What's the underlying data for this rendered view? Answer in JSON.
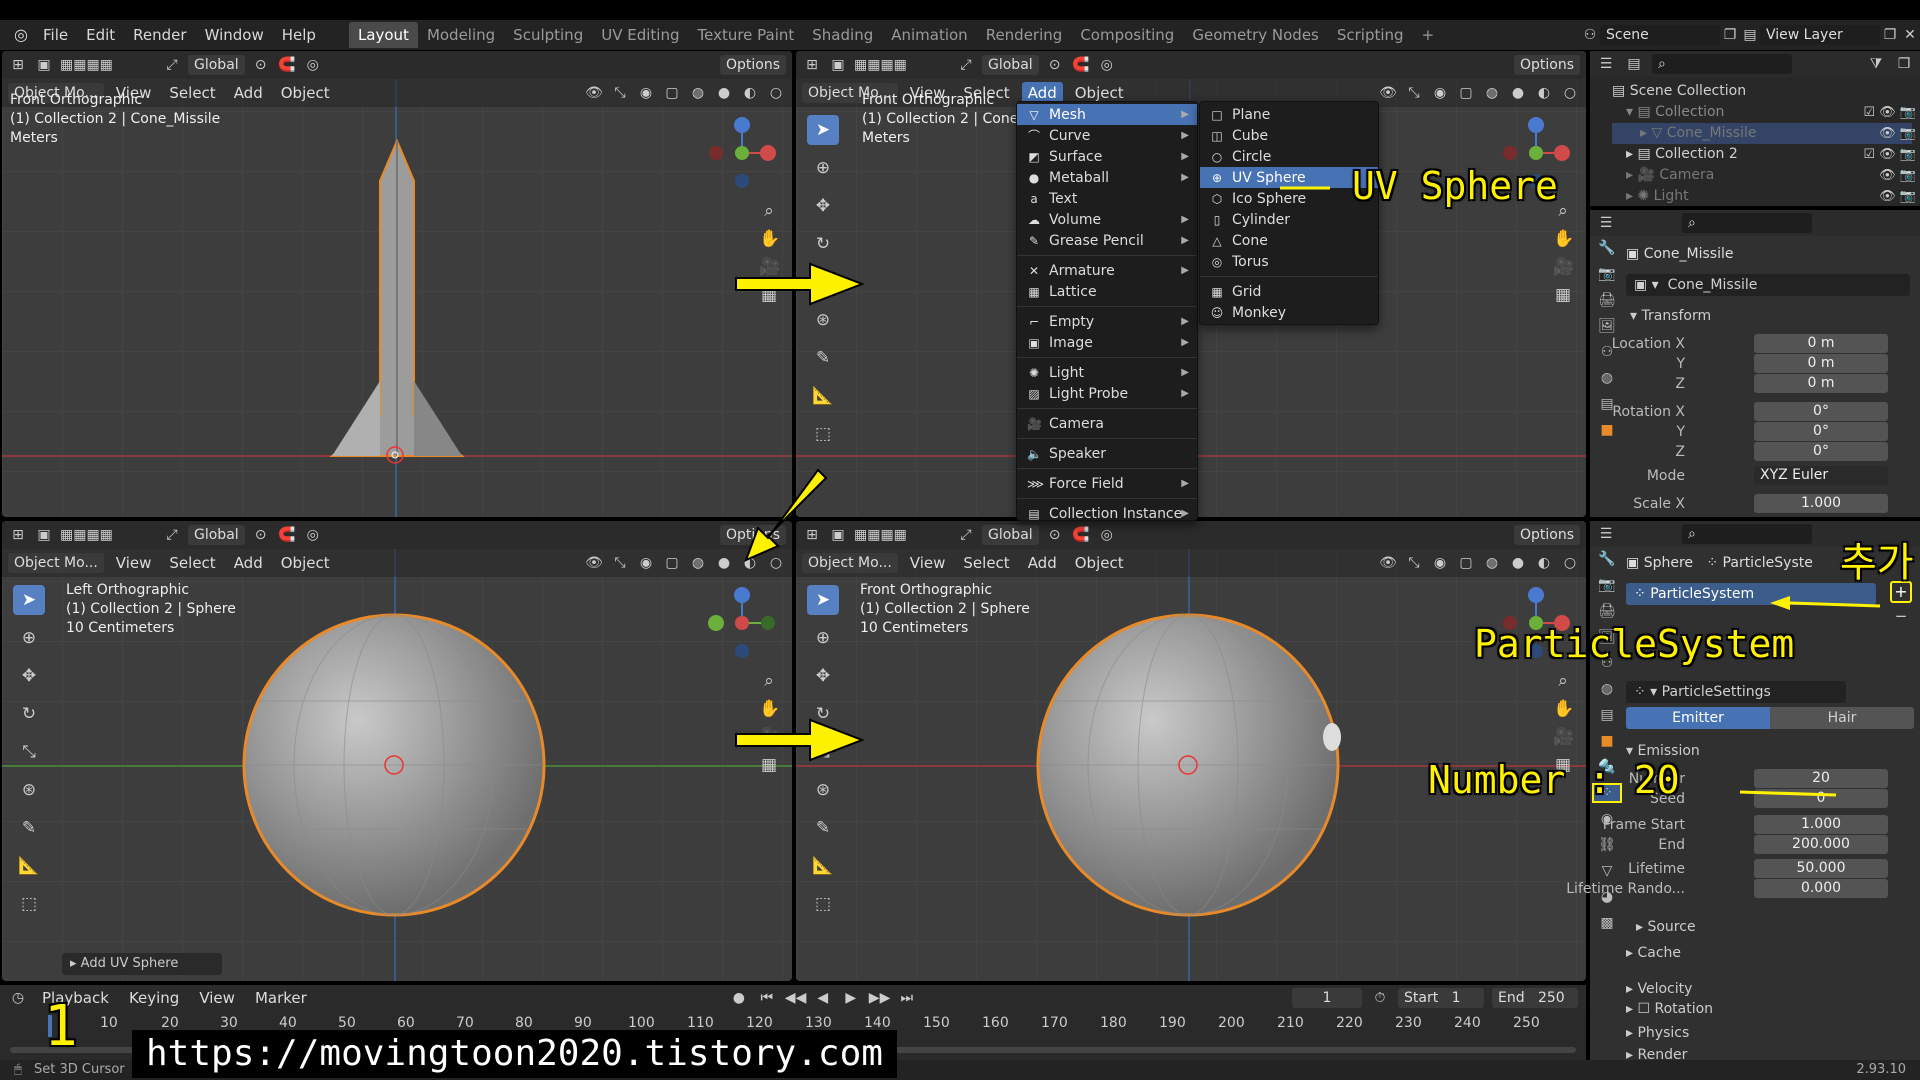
{
  "menubar": {
    "file": "File",
    "edit": "Edit",
    "render": "Render",
    "window": "Window",
    "help": "Help"
  },
  "workspaces": [
    "Layout",
    "Modeling",
    "Sculpting",
    "UV Editing",
    "Texture Paint",
    "Shading",
    "Animation",
    "Rendering",
    "Compositing",
    "Geometry Nodes",
    "Scripting"
  ],
  "scene": {
    "scene_label": "Scene",
    "view_layer": "View Layer"
  },
  "header": {
    "global": "Global",
    "options": "Options",
    "object_mode": "Object Mo...",
    "view": "View",
    "select": "Select",
    "add": "Add",
    "object": "Object"
  },
  "viewports": {
    "tl": {
      "view_name": "Front Orthographic",
      "collection": "(1) Collection 2 | Cone_Missile",
      "units": "Meters"
    },
    "tr": {
      "view_name": "Front Orthographic",
      "collection": "(1) Collection 2 | Cone_M",
      "units": "Meters"
    },
    "bl": {
      "view_name": "Left Orthographic",
      "collection": "(1) Collection 2 | Sphere",
      "units": "10 Centimeters",
      "last_op": "Add UV Sphere"
    },
    "br": {
      "view_name": "Front Orthographic",
      "collection": "(1) Collection 2 | Sphere",
      "units": "10 Centimeters"
    }
  },
  "add_menu": {
    "items": [
      "Mesh",
      "Curve",
      "Surface",
      "Metaball",
      "Text",
      "Volume",
      "Grease Pencil",
      "Armature",
      "Lattice",
      "Empty",
      "Image",
      "Light",
      "Light Probe",
      "Camera",
      "Speaker",
      "Force Field",
      "Collection Instance"
    ],
    "mesh_items": [
      "Plane",
      "Cube",
      "Circle",
      "UV Sphere",
      "Ico Sphere",
      "Cylinder",
      "Cone",
      "Torus",
      "Grid",
      "Monkey"
    ]
  },
  "outliner": {
    "scene_collection": "Scene Collection",
    "collection": "Collection",
    "cone_missile": "Cone_Missile",
    "collection2": "Collection 2",
    "camera": "Camera",
    "light": "Light"
  },
  "props_top": {
    "object_name": "Cone_Missile",
    "data_name": "Cone_Missile",
    "transform": "Transform",
    "location_x_label": "Location X",
    "location_x": "0 m",
    "y_label": "Y",
    "location_y": "0 m",
    "z_label": "Z",
    "location_z": "0 m",
    "rotation_x_label": "Rotation X",
    "rotation_x": "0°",
    "rotation_y": "0°",
    "rotation_z": "0°",
    "mode_label": "Mode",
    "mode": "XYZ Euler",
    "scale_label": "Scale X",
    "scale_x": "1.000"
  },
  "props_bottom": {
    "object": "Sphere",
    "particles_tab": "ParticleSyste",
    "particle_system": "ParticleSystem",
    "settings": "ParticleSettings",
    "emitter": "Emitter",
    "hair": "Hair",
    "emission": "Emission",
    "number_label": "Number",
    "number": "20",
    "seed_label": "Seed",
    "seed": "0",
    "frame_start_label": "Frame Start",
    "frame_start": "1.000",
    "end_label": "End",
    "frame_end": "200.000",
    "lifetime_label": "Lifetime",
    "lifetime": "50.000",
    "lifetime_random_label": "Lifetime Rando...",
    "lifetime_random": "0.000",
    "source": "Source",
    "cache": "Cache",
    "velocity": "Velocity",
    "rotation": "Rotation",
    "physics": "Physics",
    "render": "Render"
  },
  "timeline": {
    "playback": "Playback",
    "keying": "Keying",
    "view": "View",
    "marker": "Marker",
    "current": "1",
    "start_label": "Start",
    "start": "1",
    "end_label": "End",
    "end": "250",
    "ticks": [
      "10",
      "20",
      "30",
      "40",
      "50",
      "60",
      "70",
      "80",
      "90",
      "100",
      "110",
      "120",
      "130",
      "140",
      "150",
      "160",
      "170",
      "180",
      "190",
      "200",
      "210",
      "220",
      "230",
      "240",
      "250"
    ]
  },
  "status": {
    "hint": "Set 3D Cursor",
    "version": "2.93.10"
  },
  "annotations": {
    "uv_sphere": "UV Sphere",
    "add": "추가",
    "particle_system": "ParticleSystem",
    "number": "Number : 20",
    "step": "1",
    "url": "https://movingtoon2020.tistory.com"
  }
}
